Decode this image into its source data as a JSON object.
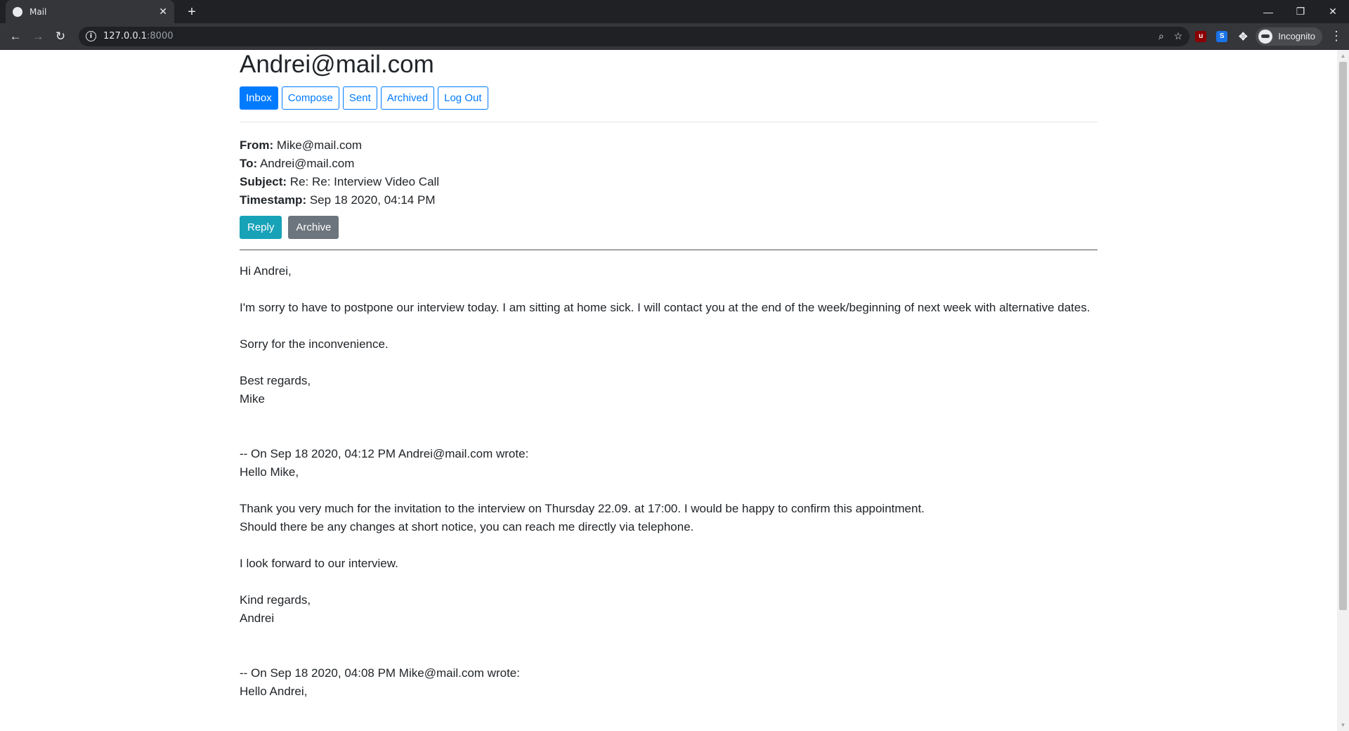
{
  "browser": {
    "tab_title": "Mail",
    "url_host": "127.0.0.1",
    "url_port": ":8000",
    "profile_label": "Incognito"
  },
  "page": {
    "title": "Andrei@mail.com",
    "nav": [
      {
        "label": "Inbox",
        "active": true
      },
      {
        "label": "Compose",
        "active": false
      },
      {
        "label": "Sent",
        "active": false
      },
      {
        "label": "Archived",
        "active": false
      },
      {
        "label": "Log Out",
        "active": false
      }
    ]
  },
  "email": {
    "from_label": "From:",
    "from": "Mike@mail.com",
    "to_label": "To:",
    "to": "Andrei@mail.com",
    "subject_label": "Subject:",
    "subject": "Re: Re: Interview Video Call",
    "timestamp_label": "Timestamp:",
    "timestamp": "Sep 18 2020, 04:14 PM",
    "reply_label": "Reply",
    "archive_label": "Archive",
    "body": "Hi Andrei,\n\nI'm sorry to have to postpone our interview today. I am sitting at home sick. I will contact you at the end of the week/beginning of next week with alternative dates.\n\nSorry for the inconvenience.\n\nBest regards,\nMike\n\n\n-- On Sep 18 2020, 04:12 PM Andrei@mail.com wrote:\nHello Mike,\n\nThank you very much for the invitation to the interview on Thursday 22.09. at 17:00. I would be happy to confirm this appointment.\nShould there be any changes at short notice, you can reach me directly via telephone.\n\nI look forward to our interview.\n\nKind regards,\nAndrei\n\n\n-- On Sep 18 2020, 04:08 PM Mike@mail.com wrote:\nHello Andrei,"
  },
  "colors": {
    "primary": "#007bff",
    "info": "#17a2b8",
    "secondary": "#6c757d"
  }
}
